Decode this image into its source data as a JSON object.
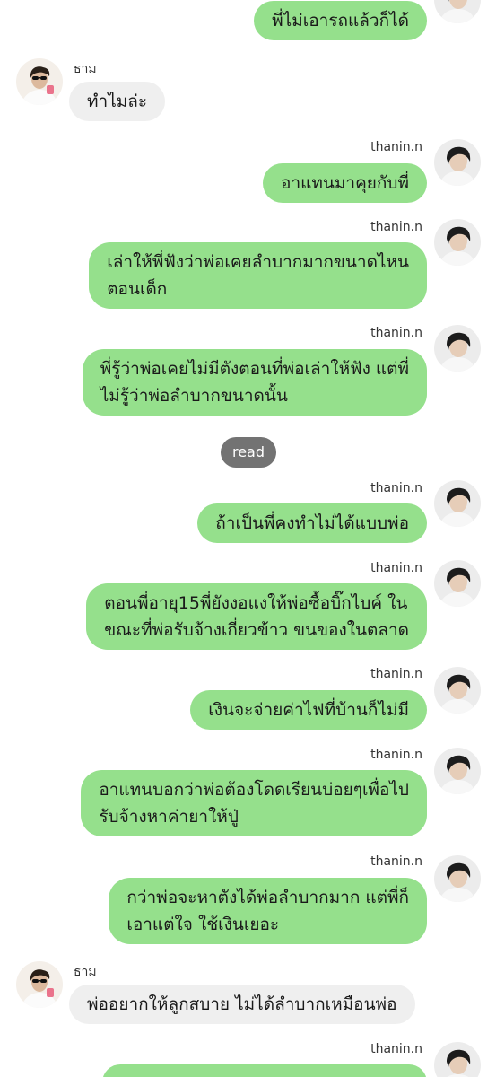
{
  "colors": {
    "outgoing_bubble": "#95e08c",
    "incoming_bubble": "#efefef",
    "read_pill": "#737373"
  },
  "contacts": {
    "other": {
      "name": "ธาม",
      "avatar_icon": "profile-photo-sunglasses"
    },
    "self": {
      "name": "thanin.n",
      "avatar_icon": "profile-photo-dark-hair"
    }
  },
  "messages": [
    {
      "sender": "thanin.n",
      "lines": [
        "พี่ไม่เอารถแล้วก็ได้"
      ]
    },
    {
      "sender": "ธาม",
      "lines": [
        "ทำไมล่ะ"
      ]
    },
    {
      "sender": "thanin.n",
      "lines": [
        "อาแทนมาคุยกับพี่"
      ]
    },
    {
      "sender": "thanin.n",
      "lines": [
        "เล่าให้พี่ฟังว่าพ่อเคยลำบากมากขนาดไหน",
        "ตอนเด็ก"
      ]
    },
    {
      "sender": "thanin.n",
      "lines": [
        "พี่รู้ว่าพ่อเคยไม่มีตังตอนที่พ่อเล่าให้ฟัง แต่พี่",
        "ไม่รู้ว่าพ่อลำบากขนาดนั้น"
      ]
    },
    {
      "sender": "thanin.n",
      "lines": [
        "ถ้าเป็นพี่คงทำไม่ได้แบบพ่อ"
      ]
    },
    {
      "sender": "thanin.n",
      "lines": [
        "ตอนพี่อายุ15พี่ยังงอแงให้พ่อซื้อบิ๊กไบค์ ใน",
        "ขณะที่พ่อรับจ้างเกี่ยวข้าว ขนของในตลาด"
      ]
    },
    {
      "sender": "thanin.n",
      "lines": [
        "เงินจะจ่ายค่าไฟที่บ้านก็ไม่มี"
      ]
    },
    {
      "sender": "thanin.n",
      "lines": [
        "อาแทนบอกว่าพ่อต้องโดดเรียนบ่อยๆเพื่อไป",
        "รับจ้างหาค่ายาให้ปู่"
      ]
    },
    {
      "sender": "thanin.n",
      "lines": [
        "กว่าพ่อจะหาตังได้พ่อลำบากมาก แต่พี่ก็",
        "เอาแต่ใจ ใช้เงินเยอะ"
      ]
    },
    {
      "sender": "ธาม",
      "lines": [
        "พ่ออยากให้ลูกสบาย ไม่ได้ลำบากเหมือนพ่อ"
      ]
    }
  ],
  "read_receipt": "read"
}
